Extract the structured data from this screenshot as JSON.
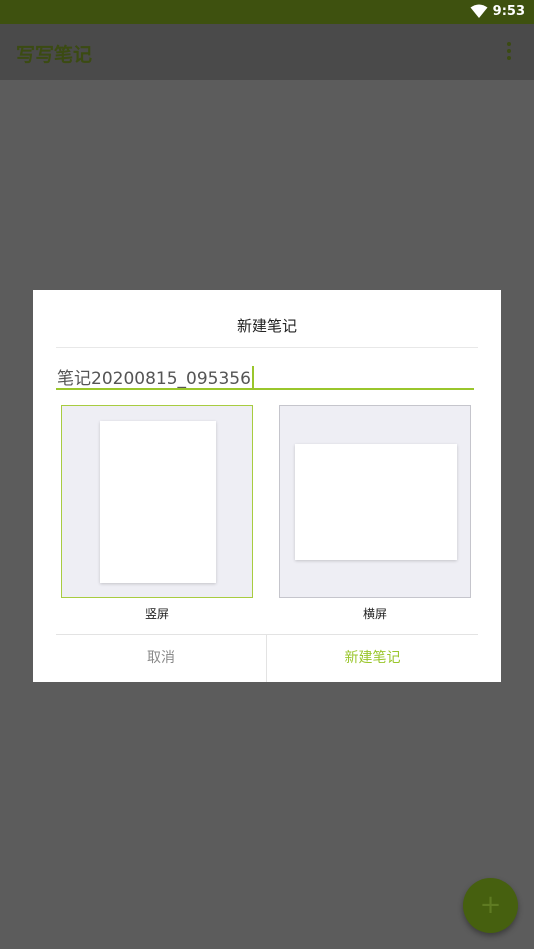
{
  "status_bar": {
    "time": "9:53",
    "wifi_icon": "wifi-icon"
  },
  "app_bar": {
    "title": "写写笔记",
    "menu_icon": "more-vert-icon"
  },
  "fab": {
    "icon": "plus-icon",
    "label": "+"
  },
  "dialog": {
    "title": "新建笔记",
    "note_name_value": "笔记20200815_095356",
    "options": [
      {
        "label": "竖屏",
        "selected": true
      },
      {
        "label": "横屏",
        "selected": false
      }
    ],
    "cancel_label": "取消",
    "create_label": "新建笔记"
  },
  "colors": {
    "accent": "#9ac62c",
    "status_bar": "#3e510f",
    "overlay": "#5c5c5c"
  }
}
